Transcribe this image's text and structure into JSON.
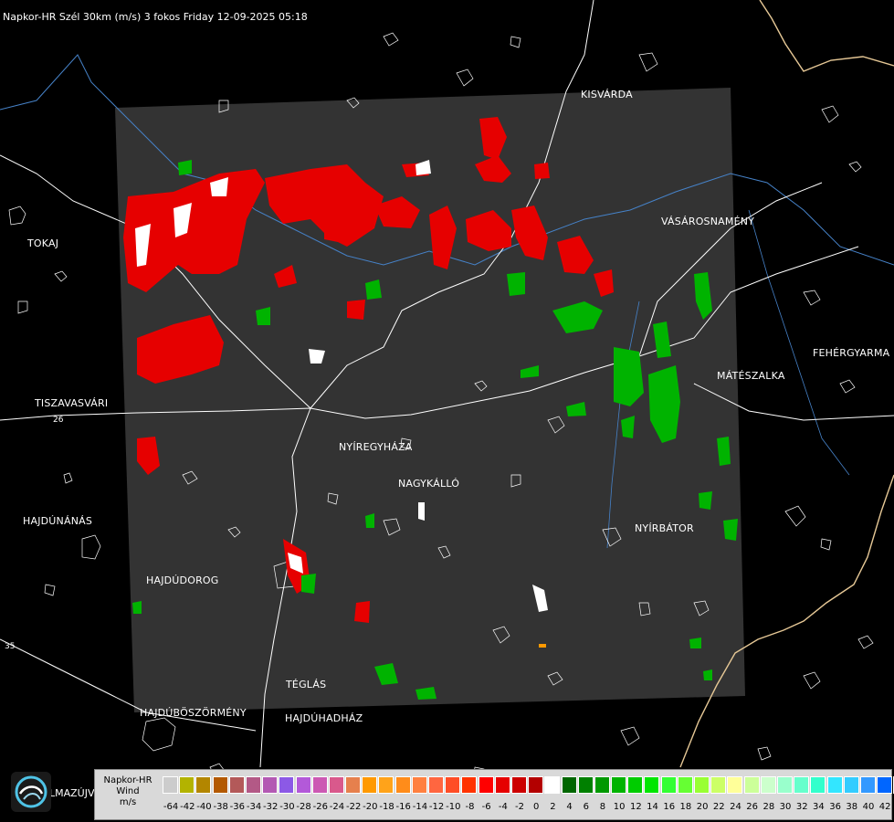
{
  "title": "Napkor-HR Szél 30km (m/s) 3 fokos Friday 12-09-2025 05:18",
  "cities": [
    {
      "name": "KISVÁRDA"
    },
    {
      "name": "VÁSÁROSNAMÉNY"
    },
    {
      "name": "TOKAJ"
    },
    {
      "name": "FEHÉRGYARMA"
    },
    {
      "name": "MÁTÉSZALKA"
    },
    {
      "name": "TISZAVASVÁRI"
    },
    {
      "name": "NYÍREGYHÁZA"
    },
    {
      "name": "NAGYKÁLLÓ"
    },
    {
      "name": "HAJDÚNÁNÁS"
    },
    {
      "name": "NYÍRBÁTOR"
    },
    {
      "name": "HAJDÚDOROG"
    },
    {
      "name": "TÉGLÁS"
    },
    {
      "name": "HAJDÚBÖSZÖRMÉNY"
    },
    {
      "name": "HAJDÚHADHÁZ"
    }
  ],
  "partial_label": "LMAZÚJVÁR",
  "road_numbers": [
    "26",
    "35"
  ],
  "legend": {
    "line1": "Napkor-HR",
    "line2": "Wind",
    "line3": "m/s",
    "colors": [
      "#cccccc",
      "#b3b300",
      "#b38600",
      "#b35900",
      "#b35959",
      "#b35986",
      "#b359b3",
      "#8c59e6",
      "#b359d9",
      "#cc59b3",
      "#d9598c",
      "#e6804d",
      "#ff9900",
      "#ffa31a",
      "#ff8c1a",
      "#ff8040",
      "#ff6640",
      "#ff4d26",
      "#ff3300",
      "#ff0000",
      "#e60000",
      "#cc0000",
      "#b30000",
      "#ffffff",
      "#006600",
      "#008000",
      "#009900",
      "#00b300",
      "#00cc00",
      "#00e600",
      "#33ff33",
      "#66ff33",
      "#99ff33",
      "#ccff66",
      "#ffff99",
      "#ccff99",
      "#ccffcc",
      "#99ffcc",
      "#66ffcc",
      "#33ffcc",
      "#33e6ff",
      "#33ccff",
      "#3399ff",
      "#0066ff",
      "#0033ff",
      "#0000ff"
    ],
    "ticks": [
      "-64",
      "-42",
      "-40",
      "-38",
      "-36",
      "-34",
      "-32",
      "-30",
      "-28",
      "-26",
      "-24",
      "-22",
      "-20",
      "-18",
      "-16",
      "-14",
      "-12",
      "-10",
      "-8",
      "-6",
      "-4",
      "-2",
      "0",
      "2",
      "4",
      "6",
      "8",
      "10",
      "12",
      "14",
      "16",
      "18",
      "20",
      "22",
      "24",
      "26",
      "28",
      "30",
      "32",
      "34",
      "36",
      "38",
      "40",
      "42"
    ]
  },
  "colors": {
    "radar_bg": "#333333",
    "inbound": "#ff0000",
    "outbound": "#00cc00",
    "border": "#e6c896",
    "rivers": "#4682c8"
  }
}
